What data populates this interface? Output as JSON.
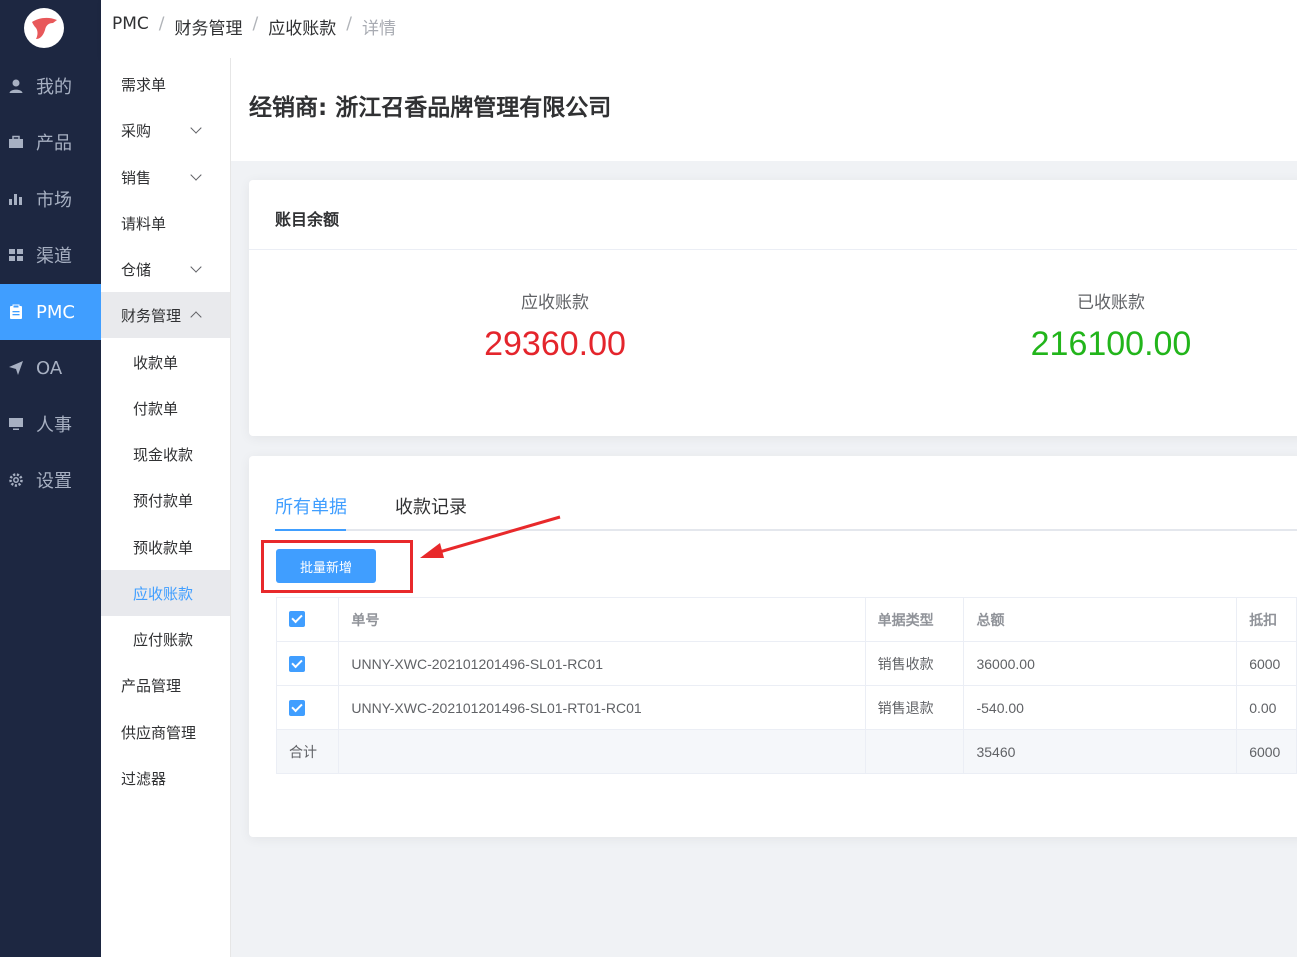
{
  "nav": {
    "items": [
      {
        "label": "我的",
        "icon": "user-icon"
      },
      {
        "label": "产品",
        "icon": "briefcase-icon"
      },
      {
        "label": "市场",
        "icon": "bar-chart-icon"
      },
      {
        "label": "渠道",
        "icon": "grid-icon"
      },
      {
        "label": "PMC",
        "icon": "clipboard-icon"
      },
      {
        "label": "OA",
        "icon": "send-icon"
      },
      {
        "label": "人事",
        "icon": "monitor-icon"
      },
      {
        "label": "设置",
        "icon": "gear-icon"
      }
    ],
    "active_color": "#409eff"
  },
  "submenu": {
    "items": [
      "需求单",
      "采购",
      "销售",
      "请料单",
      "仓储",
      "财务管理",
      "收款单",
      "付款单",
      "现金收款",
      "预付款单",
      "预收款单",
      "应收账款",
      "应付账款",
      "产品管理",
      "供应商管理",
      "过滤器"
    ]
  },
  "breadcrumb": [
    "PMC",
    "财务管理",
    "应收账款",
    "详情"
  ],
  "page": {
    "title": "经销商: 浙江召香品牌管理有限公司"
  },
  "balance": {
    "heading": "账目余额",
    "receivable_label": "应收账款",
    "receivable_value": "29360.00",
    "received_label": "已收账款",
    "received_value": "216100.00",
    "receivable_color": "#e4252c",
    "received_color": "#22b51b"
  },
  "tabs": [
    "所有单据",
    "收款记录"
  ],
  "batch_add_label": "批量新增",
  "table": {
    "headers": [
      "单号",
      "单据类型",
      "总额",
      "抵扣"
    ],
    "rows": [
      {
        "no": "UNNY-XWC-202101201496-SL01-RC01",
        "type": "销售收款",
        "total": "36000.00",
        "deduct": "6000"
      },
      {
        "no": "UNNY-XWC-202101201496-SL01-RT01-RC01",
        "type": "销售退款",
        "total": "-540.00",
        "deduct": "0.00"
      }
    ],
    "sum": {
      "label": "合计",
      "total": "35460",
      "deduct": "6000"
    }
  }
}
